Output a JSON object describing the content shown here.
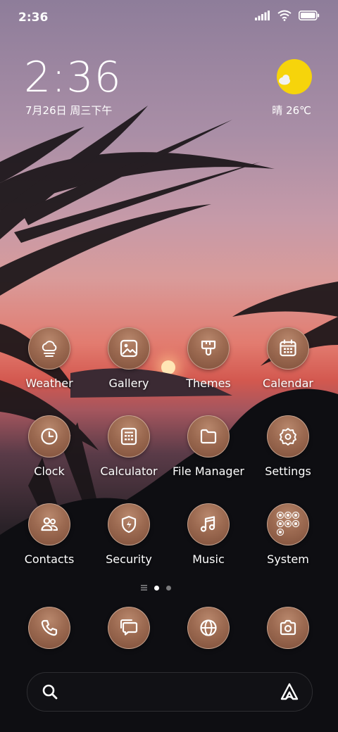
{
  "status_bar": {
    "time": "2:36",
    "icons": [
      "signal-icon",
      "wifi-icon",
      "battery-icon"
    ]
  },
  "clock": {
    "time": "2:36",
    "date": "7月26日 周三下午"
  },
  "weather": {
    "text": "晴 26℃",
    "icon": "sun-cloud-icon"
  },
  "apps": [
    {
      "label": "Weather",
      "icon": "weather-icon"
    },
    {
      "label": "Gallery",
      "icon": "gallery-icon"
    },
    {
      "label": "Themes",
      "icon": "themes-icon"
    },
    {
      "label": "Calendar",
      "icon": "calendar-icon"
    },
    {
      "label": "Clock",
      "icon": "clock-icon"
    },
    {
      "label": "Calculator",
      "icon": "calculator-icon"
    },
    {
      "label": "File Manager",
      "icon": "folder-icon"
    },
    {
      "label": "Settings",
      "icon": "gear-icon"
    },
    {
      "label": "Contacts",
      "icon": "contacts-icon"
    },
    {
      "label": "Security",
      "icon": "shield-icon"
    },
    {
      "label": "Music",
      "icon": "music-icon"
    },
    {
      "label": "System",
      "icon": "folder-grid-icon"
    }
  ],
  "dock": [
    {
      "icon": "phone-icon"
    },
    {
      "icon": "messages-icon"
    },
    {
      "icon": "browser-icon"
    },
    {
      "icon": "camera-icon"
    }
  ],
  "page_indicator": {
    "pages": 2,
    "current": 1
  },
  "search_bar": {
    "left_icon": "search-icon",
    "right_icon": "assistant-icon"
  },
  "colors": {
    "icon_bronze": "#9c6a51",
    "weather_sun": "#f6d40b"
  }
}
